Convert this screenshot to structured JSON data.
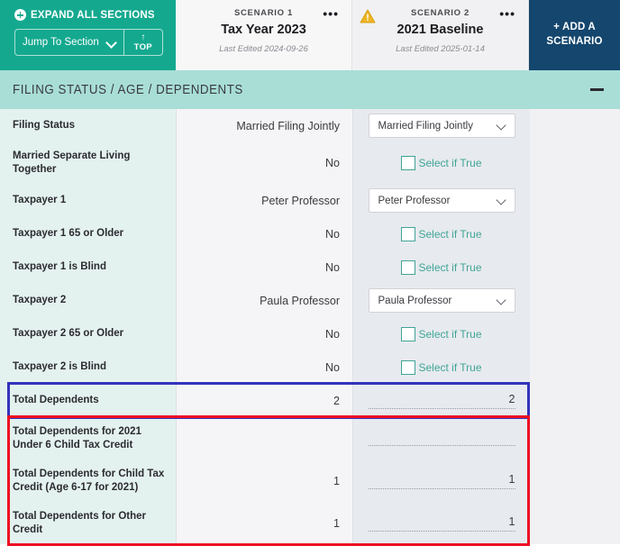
{
  "toolbar": {
    "expand_all_label": "EXPAND ALL SECTIONS",
    "jump_to_section_label": "Jump To Section",
    "top_button_label": "TOP",
    "top_arrow_glyph": "↑"
  },
  "scenarios": [
    {
      "kicker": "SCENARIO 1",
      "name": "Tax Year 2023",
      "last_edited": "Last Edited 2024-09-26",
      "menu_glyph": "•••",
      "has_warning": false
    },
    {
      "kicker": "SCENARIO 2",
      "name": "2021 Baseline",
      "last_edited": "Last Edited 2025-01-14",
      "menu_glyph": "•••",
      "has_warning": true
    }
  ],
  "add_scenario": {
    "label": "+ ADD A SCENARIO"
  },
  "section": {
    "title": "FILING STATUS / AGE / DEPENDENTS",
    "collapsed": false
  },
  "checkbox_label": "Select if True",
  "rows": [
    {
      "label": "Filing Status",
      "s1_value": "Married Filing Jointly",
      "s2_type": "select",
      "s2_value": "Married Filing Jointly"
    },
    {
      "label": "Married Separate Living Together",
      "s1_value": "No",
      "s2_type": "checkbox",
      "s2_value": "Select if True"
    },
    {
      "label": "Taxpayer 1",
      "s1_value": "Peter Professor",
      "s2_type": "select",
      "s2_value": "Peter Professor"
    },
    {
      "label": "Taxpayer 1 65 or Older",
      "s1_value": "No",
      "s2_type": "checkbox",
      "s2_value": "Select if True"
    },
    {
      "label": "Taxpayer 1 is Blind",
      "s1_value": "No",
      "s2_type": "checkbox",
      "s2_value": "Select if True"
    },
    {
      "label": "Taxpayer 2",
      "s1_value": "Paula Professor",
      "s2_type": "select",
      "s2_value": "Paula Professor"
    },
    {
      "label": "Taxpayer 2 65 or Older",
      "s1_value": "No",
      "s2_type": "checkbox",
      "s2_value": "Select if True"
    },
    {
      "label": "Taxpayer 2 is Blind",
      "s1_value": "No",
      "s2_type": "checkbox",
      "s2_value": "Select if True"
    },
    {
      "label": "Total Dependents",
      "s1_value": "2",
      "s2_type": "number",
      "s2_value": "2"
    },
    {
      "label": "Total Dependents for 2021 Under 6 Child Tax Credit",
      "s1_value": "",
      "s2_type": "number",
      "s2_value": ""
    },
    {
      "label": "Total Dependents for Child Tax Credit (Age 6-17 for 2021)",
      "s1_value": "1",
      "s2_type": "number",
      "s2_value": "1"
    },
    {
      "label": "Total Dependents for Other Credit",
      "s1_value": "1",
      "s2_type": "number",
      "s2_value": "1"
    }
  ],
  "colors": {
    "teal_toolbar": "#14a98f",
    "teal_section_header": "#a8ded6",
    "teal_label_column": "#e4f2ef",
    "navy_add_scenario": "#14466e",
    "accent_teal_text": "#3fa595",
    "highlight_blue": "#3333bb",
    "highlight_red": "#ee1122",
    "warning_amber": "#eeb422"
  }
}
